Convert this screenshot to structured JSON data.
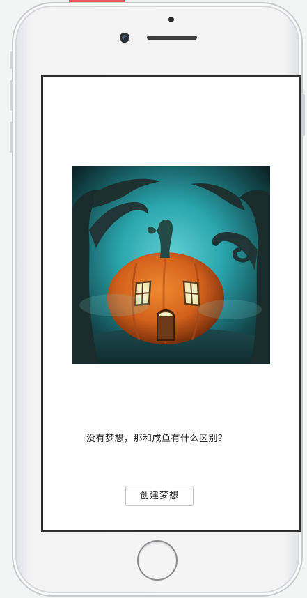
{
  "screen": {
    "image": {
      "subject": "pumpkin-house-illustration",
      "colors": {
        "background_teal": "#2aa6ad",
        "background_dark": "#0e2f33",
        "pumpkin_orange": "#d2611c",
        "window_light": "#f4f1c8"
      }
    },
    "tagline": "没有梦想，那和咸鱼有什么区别？",
    "create_button_label": "创建梦想"
  },
  "device": {
    "accent_color": "#ef5a5f"
  }
}
